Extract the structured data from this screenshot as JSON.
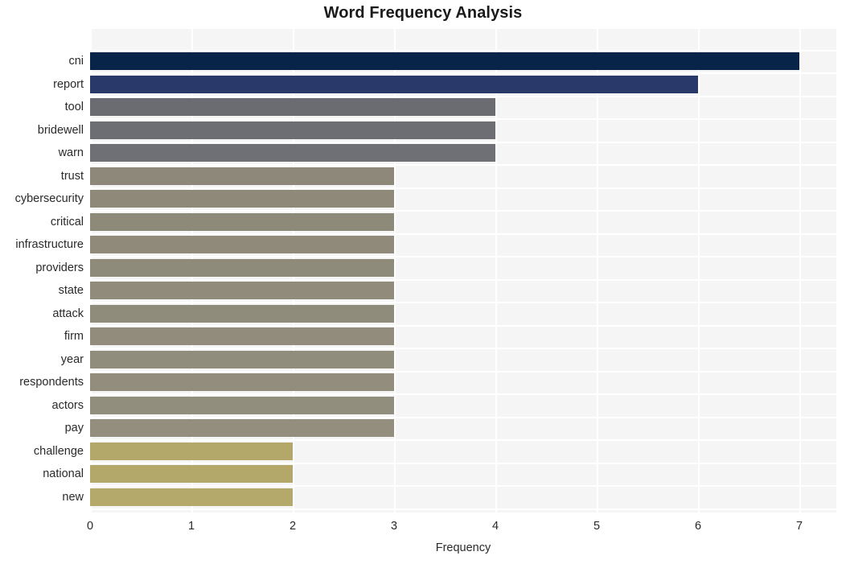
{
  "chart_data": {
    "type": "bar",
    "orientation": "horizontal",
    "title": "Word Frequency Analysis",
    "xlabel": "Frequency",
    "ylabel": "",
    "xlim": [
      0,
      7.3
    ],
    "xticks": [
      0,
      1,
      2,
      3,
      4,
      5,
      6,
      7
    ],
    "xtick_labels": [
      "0",
      "1",
      "2",
      "3",
      "4",
      "5",
      "6",
      "7"
    ],
    "grid": true,
    "legend": null,
    "categories": [
      "cni",
      "report",
      "tool",
      "bridewell",
      "warn",
      "trust",
      "cybersecurity",
      "critical",
      "infrastructure",
      "providers",
      "state",
      "attack",
      "firm",
      "year",
      "respondents",
      "actors",
      "pay",
      "challenge",
      "national",
      "new"
    ],
    "values": [
      7,
      6,
      4,
      4,
      4,
      3,
      3,
      3,
      3,
      3,
      3,
      3,
      3,
      3,
      3,
      3,
      3,
      2,
      2,
      2
    ],
    "bar_colors": [
      "#082449",
      "#29396a",
      "#6a6c72",
      "#6c6e74",
      "#6e7076",
      "#8d8879",
      "#8e8979",
      "#8e8a7a",
      "#8f8a7a",
      "#8f8b7b",
      "#908b7b",
      "#908c7c",
      "#918c7c",
      "#918d7d",
      "#928d7d",
      "#928e7e",
      "#938e7e",
      "#b3a86a",
      "#b3a86a",
      "#b4a96b"
    ],
    "plot_background": "#f5f5f6",
    "gridline_color": "#ffffff",
    "figure_background": "#ffffff"
  }
}
